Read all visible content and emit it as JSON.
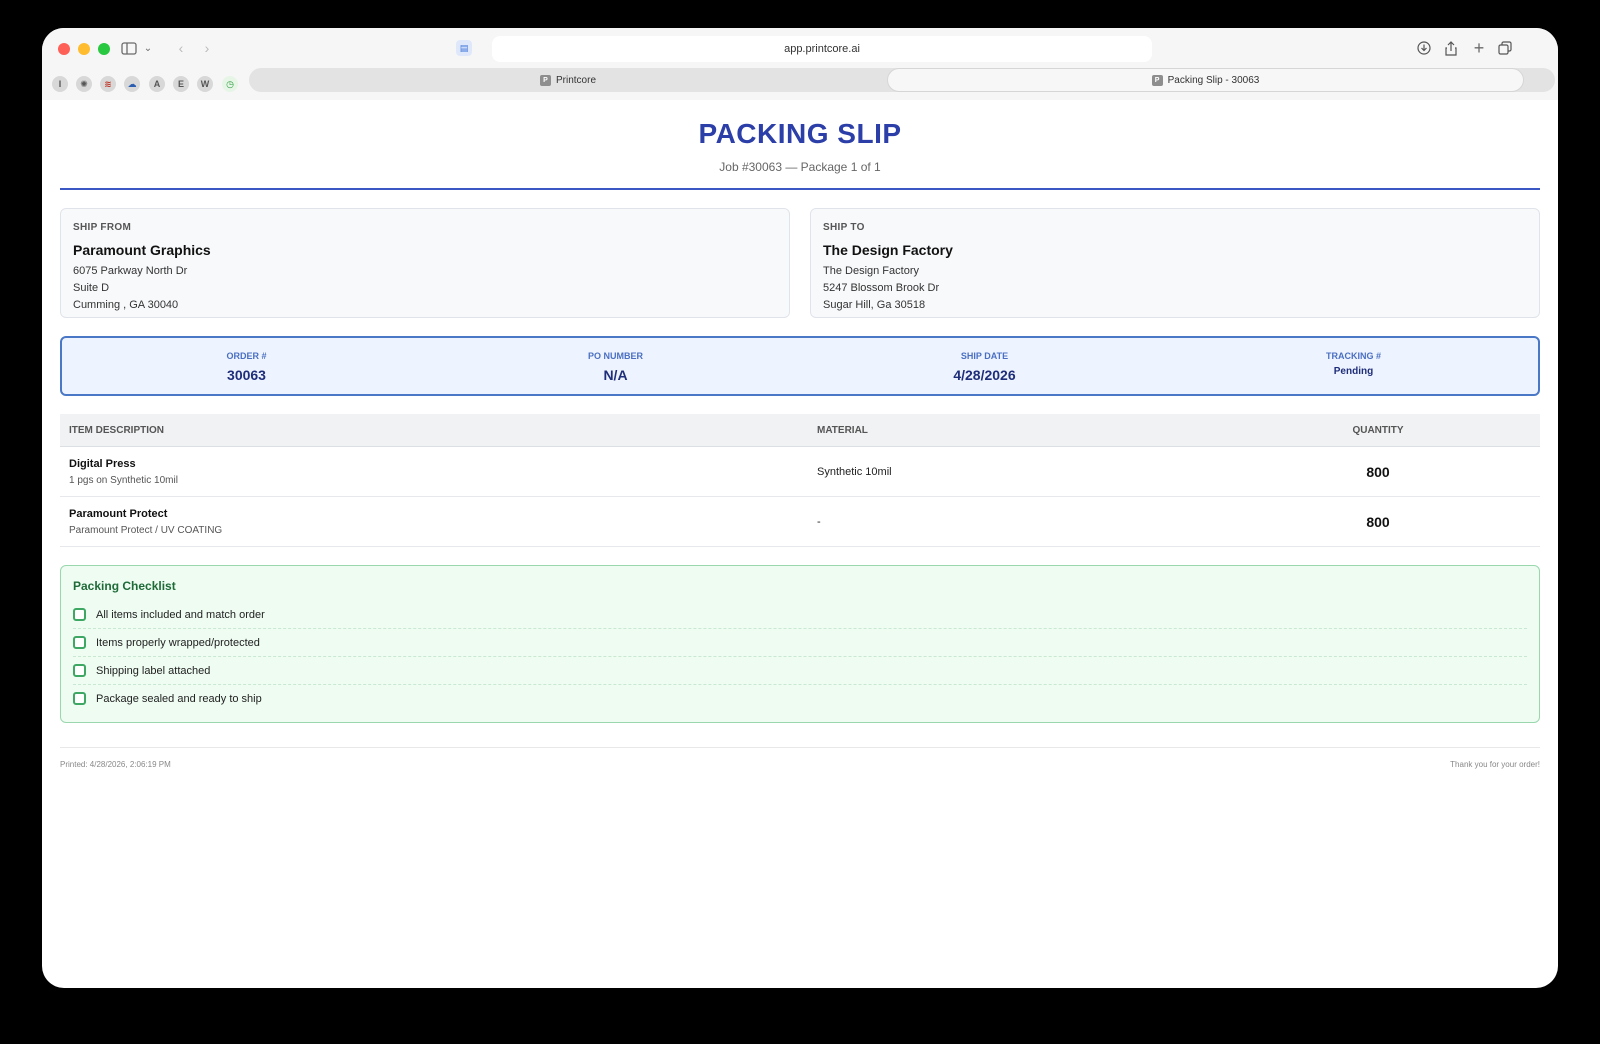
{
  "browser": {
    "url": "app.printcore.ai",
    "tabs": [
      {
        "label": "Printcore",
        "favicon": "P",
        "active": false
      },
      {
        "label": "Packing Slip - 30063",
        "favicon": "P",
        "active": true
      }
    ],
    "favorites": [
      "I",
      "",
      "",
      "",
      "A",
      "E",
      "W",
      ""
    ]
  },
  "slip": {
    "title": "PACKING SLIP",
    "subtitle": "Job #30063 — Package 1 of 1",
    "ship_from": {
      "label": "SHIP FROM",
      "name": "Paramount Graphics",
      "lines": [
        "6075 Parkway North Dr",
        "Suite D",
        "Cumming , GA 30040"
      ]
    },
    "ship_to": {
      "label": "SHIP TO",
      "name": "The Design Factory",
      "lines": [
        "The Design Factory",
        "5247 Blossom Brook Dr",
        "Sugar Hill, Ga 30518"
      ]
    },
    "order": [
      {
        "label": "ORDER #",
        "value": "30063"
      },
      {
        "label": "PO NUMBER",
        "value": "N/A"
      },
      {
        "label": "SHIP DATE",
        "value": "4/28/2026"
      },
      {
        "label": "TRACKING #",
        "value": "Pending"
      }
    ],
    "table": {
      "headers": [
        "ITEM DESCRIPTION",
        "MATERIAL",
        "QUANTITY"
      ],
      "rows": [
        {
          "name": "Digital Press",
          "desc": "1 pgs on Synthetic 10mil",
          "material": "Synthetic 10mil",
          "qty": "800"
        },
        {
          "name": "Paramount Protect",
          "desc": "Paramount Protect / UV COATING",
          "material": "-",
          "qty": "800"
        }
      ]
    },
    "checklist": {
      "title": "Packing Checklist",
      "items": [
        "All items included and match order",
        "Items properly wrapped/protected",
        "Shipping label attached",
        "Package sealed and ready to ship"
      ]
    },
    "footer": {
      "printed": "Printed: 4/28/2026, 2:06:19 PM",
      "thanks": "Thank you for your order!"
    }
  },
  "colors": {
    "accent": "#2c3ea8",
    "rule": "#3b57c4",
    "check": "#3ea764"
  }
}
